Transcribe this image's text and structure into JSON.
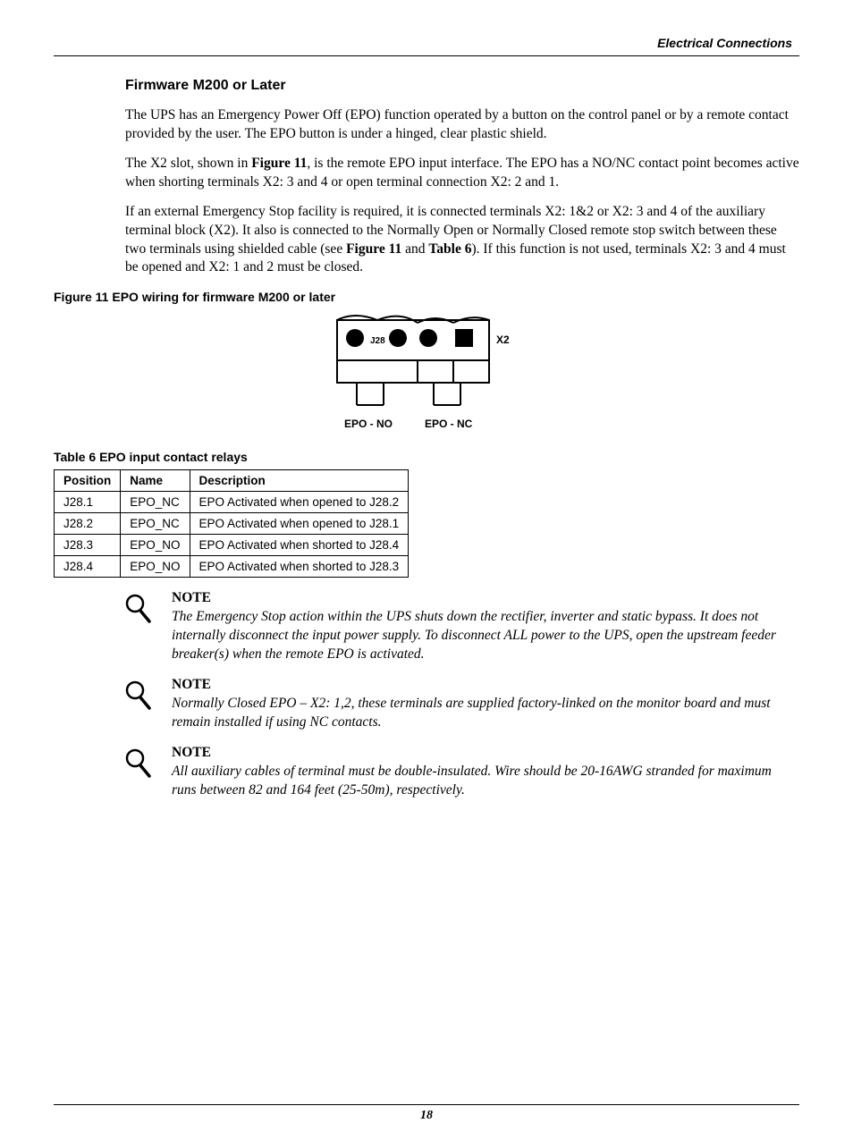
{
  "header": {
    "section": "Electrical Connections"
  },
  "section": {
    "title": "Firmware M200 or Later",
    "p1": "The UPS has an Emergency Power Off (EPO) function operated by a button on the control panel or by a remote contact provided by the user. The EPO button is under a hinged, clear plastic shield.",
    "p2a": "The X2 slot, shown in ",
    "p2b_bold": "Figure 11",
    "p2c": ", is the remote EPO input interface. The EPO has a NO/NC contact point becomes active when shorting terminals X2: 3 and 4 or open terminal connection X2: 2 and 1.",
    "p3a": "If an external Emergency Stop facility is required, it is connected terminals X2: 1&2 or X2: 3 and 4 of the auxiliary terminal block (X2). It also is connected to the Normally Open or Normally Closed remote stop switch between these two terminals using shielded cable (see ",
    "p3b_bold": "Figure 11",
    "p3c": " and ",
    "p3d_bold": "Table 6",
    "p3e": "). If this function is not used, terminals X2: 3 and 4 must be opened and X2: 1 and 2 must be closed."
  },
  "figure11": {
    "caption": "Figure 11   EPO wiring for firmware M200 or later",
    "label_j28": "J28",
    "label_x2": "X2",
    "label_no": "EPO - NO",
    "label_nc": "EPO - NC"
  },
  "table6": {
    "caption": "Table 6       EPO input contact relays",
    "headers": {
      "position": "Position",
      "name": "Name",
      "description": "Description"
    },
    "rows": [
      {
        "position": "J28.1",
        "name": "EPO_NC",
        "description": "EPO Activated when opened to J28.2"
      },
      {
        "position": "J28.2",
        "name": "EPO_NC",
        "description": "EPO Activated when opened to J28.1"
      },
      {
        "position": "J28.3",
        "name": "EPO_NO",
        "description": "EPO Activated when shorted to J28.4"
      },
      {
        "position": "J28.4",
        "name": "EPO_NO",
        "description": "EPO Activated when shorted to J28.3"
      }
    ]
  },
  "notes": [
    {
      "title": "NOTE",
      "body": "The Emergency Stop action within the UPS shuts down the rectifier, inverter and static bypass. It does not internally disconnect the input power supply. To disconnect ALL power to the UPS, open the upstream feeder breaker(s) when the remote EPO is activated."
    },
    {
      "title": "NOTE",
      "body": "Normally Closed EPO – X2: 1,2, these terminals are supplied factory-linked on the monitor board and must remain installed if using NC contacts."
    },
    {
      "title": "NOTE",
      "body": "All auxiliary cables of terminal must be double-insulated. Wire should be 20-16AWG stranded for maximum runs between 82 and 164 feet (25-50m), respectively."
    }
  ],
  "page_number": "18"
}
